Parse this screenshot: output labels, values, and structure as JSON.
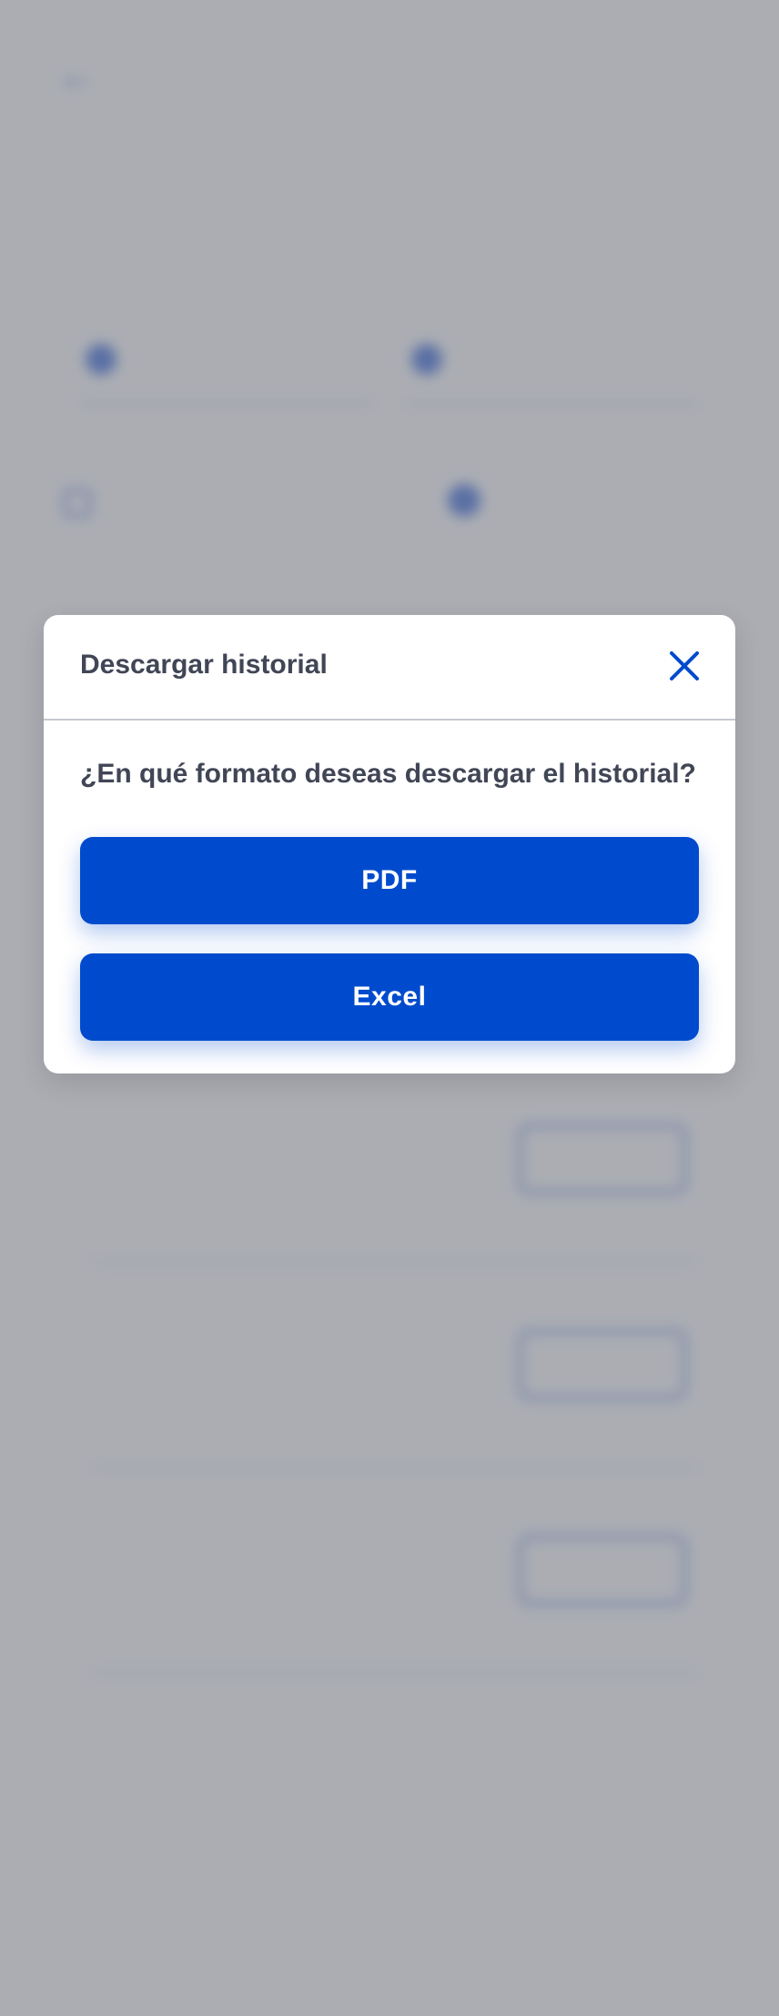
{
  "background": {
    "back_label": "",
    "title": "",
    "filter_title": "",
    "radio_1": "",
    "radio_2": "",
    "sort_label": "",
    "download_link": "",
    "section_title": "",
    "transactions": [
      {
        "title": "",
        "amount": "",
        "date": "",
        "button": ""
      },
      {
        "title": "",
        "amount": "",
        "date": "",
        "button": ""
      },
      {
        "title": "",
        "amount": "",
        "date": "",
        "button": ""
      }
    ],
    "more_link": ""
  },
  "modal": {
    "title": "Descargar historial",
    "question": "¿En qué formato deseas descargar el historial?",
    "pdf_label": "PDF",
    "excel_label": "Excel",
    "close_icon": "close-icon"
  },
  "colors": {
    "primary": "#004bcd",
    "text_dark": "#414656",
    "overlay": "#787b84"
  }
}
